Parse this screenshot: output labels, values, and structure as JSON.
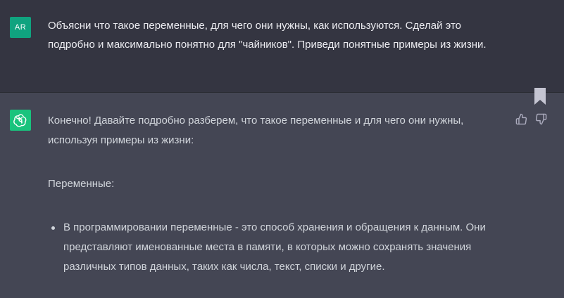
{
  "user_message": {
    "avatar_initials": "AR",
    "text": "Объясни что такое переменные,  для чего они нужны, как используются. Сделай это подробно и максимально понятно для \"чайников\". Приведи понятные примеры из жизни."
  },
  "assistant_message": {
    "avatar_icon": "openai-logo-icon",
    "intro": "Конечно! Давайте подробно разберем, что такое переменные и для чего они нужны, используя примеры из жизни:",
    "section_heading": "Переменные:",
    "bullets": [
      "В программировании переменные - это способ хранения и обращения к данным. Они представляют именованные места в памяти, в которых можно сохранять значения различных типов данных, таких как числа, текст, списки и другие."
    ]
  },
  "actions": {
    "bookmark_icon": "bookmark-icon",
    "thumb_up_icon": "thumbs-up-icon",
    "thumb_down_icon": "thumbs-down-icon"
  },
  "colors": {
    "user_bg": "#343541",
    "assistant_bg": "#444654",
    "user_avatar": "#10a37f",
    "bot_avatar": "#19c37d",
    "text": "#ececf1"
  }
}
